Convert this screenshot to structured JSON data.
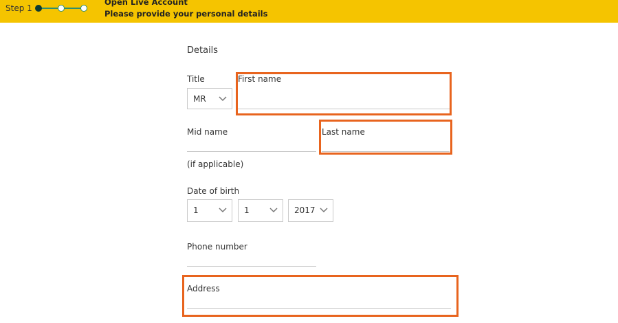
{
  "header": {
    "step_label": "Step 1",
    "title": "Open Live Account",
    "subtitle": "Please provide your personal details",
    "steps_total": 3,
    "current_step": 1
  },
  "form": {
    "section_title": "Details",
    "title_field": {
      "label": "Title",
      "value": "MR"
    },
    "first_name": {
      "label": "First name",
      "value": ""
    },
    "mid_name": {
      "label": "Mid name",
      "value": "",
      "hint": "(if applicable)"
    },
    "last_name": {
      "label": "Last name",
      "value": ""
    },
    "date_of_birth": {
      "label": "Date of birth",
      "day": "1",
      "month": "1",
      "year": "2017"
    },
    "phone_number": {
      "label": "Phone number",
      "value": ""
    },
    "address": {
      "label": "Address",
      "value": ""
    }
  },
  "colors": {
    "banner": "#f5c400",
    "stepper": "#2f8f6f",
    "highlight": "#e8641e"
  }
}
